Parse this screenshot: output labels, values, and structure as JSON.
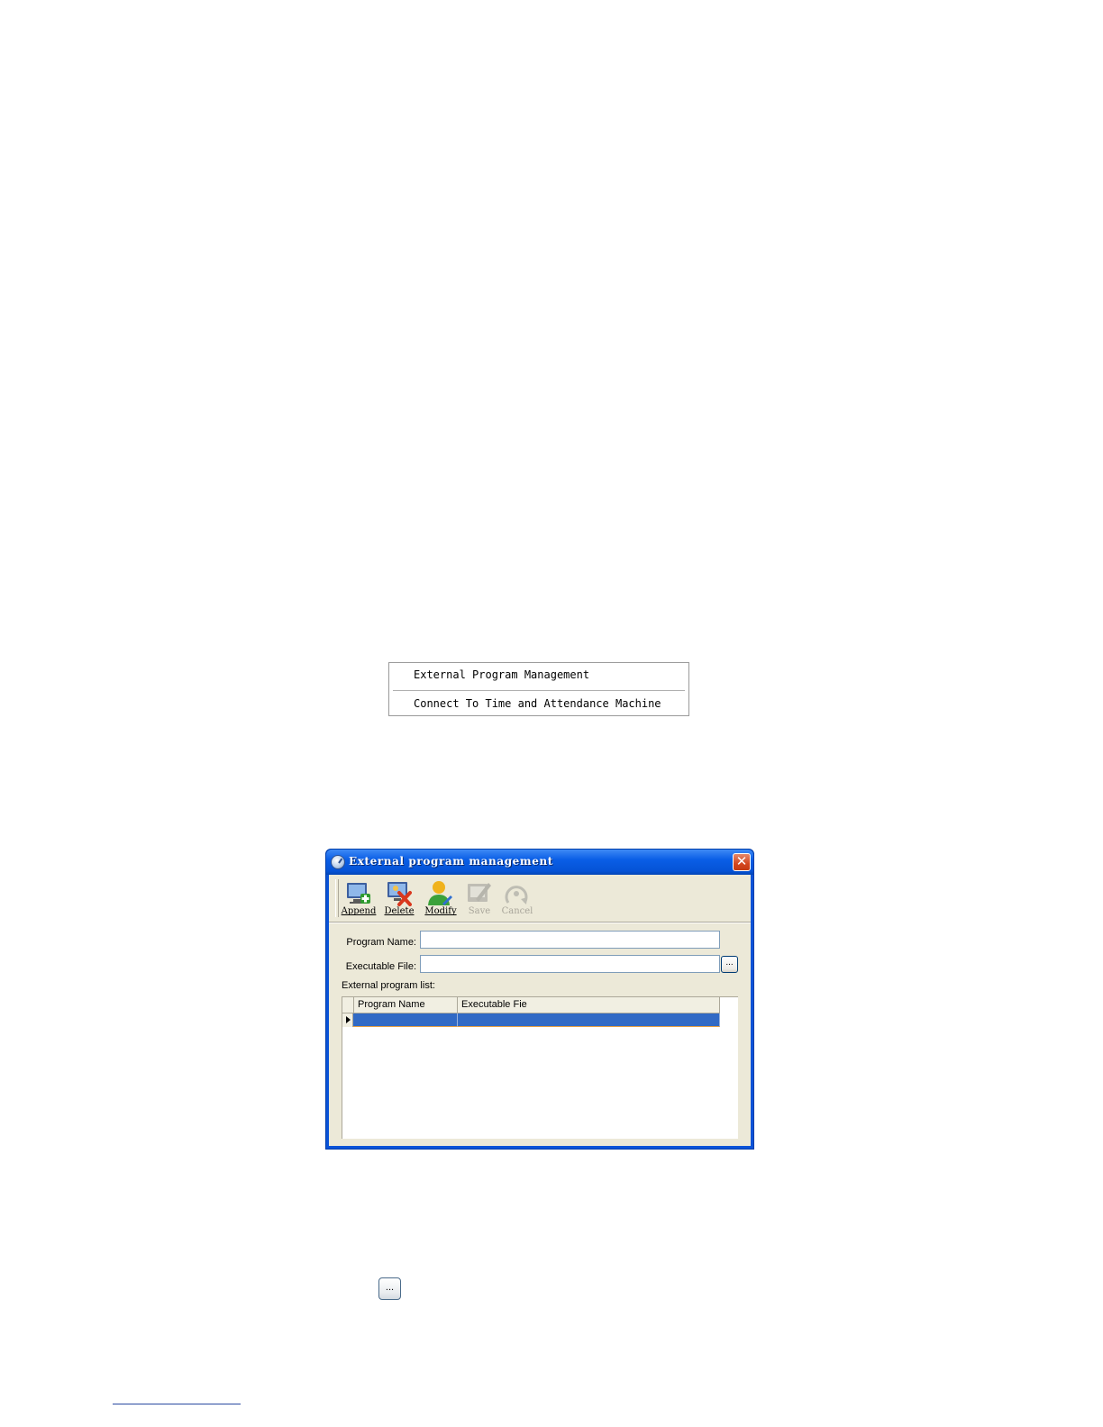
{
  "context_menu": {
    "items": [
      {
        "label": "External Program Management"
      },
      {
        "label": "Connect To Time and Attendance Machine"
      }
    ]
  },
  "dialog": {
    "title": "External program management",
    "close_label": "✕",
    "toolbar": {
      "append": "Append",
      "delete": "Delete",
      "modify": "Modify",
      "save": "Save",
      "cancel": "Cancel"
    },
    "program_name_label": "Program Name:",
    "program_name_value": "",
    "executable_file_label": "Executable File:",
    "executable_file_value": "",
    "browse_label": "...",
    "list_label": "External program list:",
    "grid": {
      "columns": [
        "Program Name",
        "Executable Fie"
      ],
      "rows": [
        [
          "",
          ""
        ]
      ]
    }
  },
  "standalone_browse_label": "..."
}
